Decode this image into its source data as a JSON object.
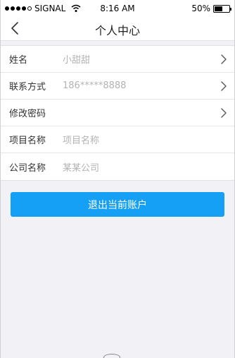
{
  "status_bar": {
    "carrier": "SIGNAL",
    "time": "8:16 AM",
    "battery": "50%",
    "battery_level": 0.5
  },
  "nav": {
    "title": "个人中心",
    "back_icon": "chevron-left-icon"
  },
  "profile_rows": [
    {
      "label": "姓名",
      "value": "小甜甜",
      "has_chevron": true
    },
    {
      "label": "联系方式",
      "value": "186*****8888",
      "has_chevron": true
    },
    {
      "label": "修改密码",
      "value": "",
      "has_chevron": true
    },
    {
      "label": "项目名称",
      "value": "项目名称",
      "has_chevron": false
    },
    {
      "label": "公司名称",
      "value": "某某公司",
      "has_chevron": false
    }
  ],
  "logout_label": "退出当前账户",
  "colors": {
    "accent": "#16a0f5",
    "background": "#f2f2f6",
    "placeholder_text": "#b3b3b3"
  }
}
